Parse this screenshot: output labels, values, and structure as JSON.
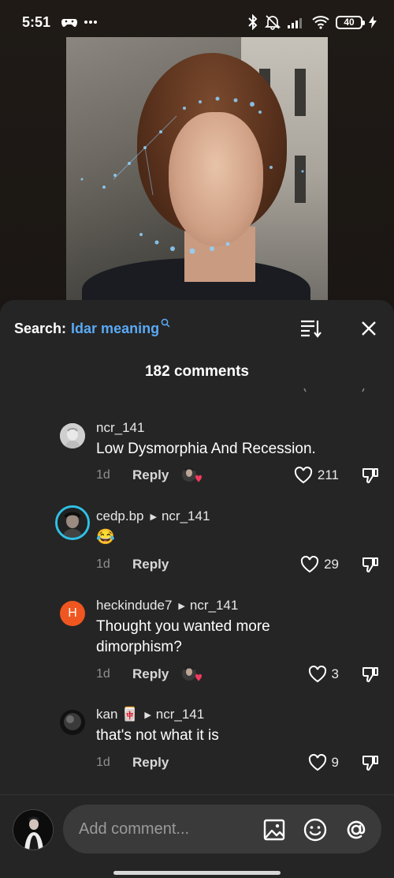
{
  "status_bar": {
    "time": "5:51",
    "battery": "40"
  },
  "search": {
    "label": "Search:",
    "term": "Idar meaning"
  },
  "comment_count": "182 comments",
  "comments": [
    {
      "user": "ncr_141",
      "reply_to": "",
      "text": "Low Dysmorphia And Recession.",
      "age": "1d",
      "reply": "Reply",
      "likes": "211",
      "avatar_color": "#d9d9d9"
    },
    {
      "user": "cedp.bp",
      "reply_to": "ncr_141",
      "text": "😂",
      "age": "1d",
      "reply": "Reply",
      "likes": "29",
      "avatar_color": "#2a2a2a"
    },
    {
      "user": "heckindude7",
      "reply_to": "ncr_141",
      "text": "Thought you wanted more dimorphism?",
      "age": "1d",
      "reply": "Reply",
      "likes": "3",
      "avatar_color": "#f0561f",
      "avatar_letter": "H"
    },
    {
      "user": "kan 🀄",
      "reply_to": "ncr_141",
      "text": "that's not what it is",
      "age": "1d",
      "reply": "Reply",
      "likes": "9",
      "avatar_color": "#1c1c1c"
    }
  ],
  "composer": {
    "placeholder": "Add comment..."
  },
  "colors": {
    "accent": "#5aa9f5",
    "sheet": "#252525",
    "avatar_h": "#f0561f",
    "ring": "#2fc1e6"
  },
  "icons": [
    "bluetooth-icon",
    "mute-icon",
    "signal-icon",
    "wifi-icon",
    "battery-icon",
    "sort-icon",
    "close-icon",
    "heart-icon",
    "dislike-icon",
    "image-icon",
    "emoji-icon",
    "mention-icon"
  ]
}
